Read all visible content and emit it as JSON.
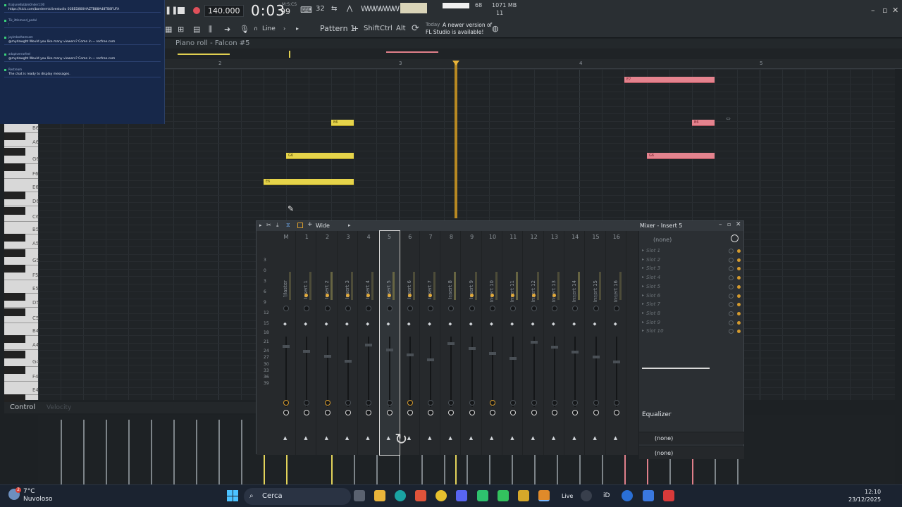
{
  "transport": {
    "tempo": "140.000",
    "time": "0:03",
    "time_sub": "99",
    "time_unit": "M:S:CS",
    "pattern": "Pattern 1",
    "snap": "Line",
    "cpu": "68",
    "memory": "1071 MB",
    "polyphony": "11",
    "news_prefix": "Today",
    "news_line1": "A newer version of",
    "news_line2": "FL Studio is available!",
    "shift": "Shift",
    "ctrl": "Ctrl",
    "alt": "Alt"
  },
  "chat": {
    "messages": [
      {
        "user": "ItsoJuneBubbleOnder1:00",
        "text": "https://kick.com/bordermiclivestudio 01BED800HAZTB88A48TB8FUFA"
      },
      {
        "user": "Tik_ittlemond_pedal",
        "text": ":"
      },
      {
        "user": "jayimbothamsam",
        "text": "@mydawght Would you like many viewers? Come in ~ recfree.com"
      },
      {
        "user": "adaptverrarfeel",
        "text": "@mydawght Would you like many viewers? Come in ~ recfree.com"
      },
      {
        "user": "Restream",
        "text": "The chat is ready to display messages."
      }
    ]
  },
  "piano_roll": {
    "title": "Piano roll - Falcon #5",
    "ruler": [
      "2",
      "3",
      "4",
      "5"
    ],
    "keys": [
      "B6",
      "A6",
      "G6",
      "F6",
      "E6",
      "D6",
      "C6",
      "B5",
      "A5",
      "G5",
      "F5",
      "E5",
      "D5",
      "C5",
      "B4",
      "A4",
      "G4",
      "F4",
      "E4"
    ],
    "notes": [
      {
        "label": "B6",
        "color": "yellow"
      },
      {
        "label": "G6",
        "color": "yellow"
      },
      {
        "label": "E6",
        "color": "yellow"
      },
      {
        "label": "E7",
        "color": "red"
      },
      {
        "label": "B6",
        "color": "red"
      },
      {
        "label": "G6",
        "color": "red"
      }
    ],
    "control_label": "Control",
    "control_target": "Velocity"
  },
  "mixer": {
    "title": "Mixer - Insert 5",
    "preset": "Wide",
    "strips": [
      "C",
      "M",
      "1",
      "2",
      "3",
      "4",
      "5",
      "6",
      "7",
      "8",
      "9",
      "10",
      "11",
      "12",
      "13",
      "14",
      "15",
      "16"
    ],
    "names": [
      "",
      "Master",
      "Insert 1",
      "Insert 2",
      "Insert 3",
      "Insert 4",
      "Insert 5",
      "Insert 6",
      "Insert 7",
      "Insert 8",
      "Insert 9",
      "Insert 10",
      "Insert 11",
      "Insert 12",
      "Insert 13",
      "Insert 14",
      "Insert 15",
      "Insert 16"
    ],
    "db_scale": [
      "3",
      "0",
      "3",
      "6",
      "9",
      "12",
      "15",
      "18",
      "21",
      "24",
      "27",
      "30",
      "33",
      "36",
      "39"
    ],
    "input": "(none)",
    "slots": [
      "Slot 1",
      "Slot 2",
      "Slot 3",
      "Slot 4",
      "Slot 5",
      "Slot 6",
      "Slot 7",
      "Slot 8",
      "Slot 9",
      "Slot 10"
    ],
    "equalizer": "Equalizer",
    "output1": "(none)",
    "output2": "(none)"
  },
  "taskbar": {
    "temp": "7°C",
    "weather": "Nuvoloso",
    "search": "Cerca",
    "time": "12:10",
    "date": "23/12/2025",
    "live": "Live",
    "weather_badge": "2"
  },
  "colors": {
    "note_yellow": "#e6d44a",
    "note_red": "#e4838e",
    "playhead": "#c89422",
    "chat_bg": "#17284a"
  }
}
